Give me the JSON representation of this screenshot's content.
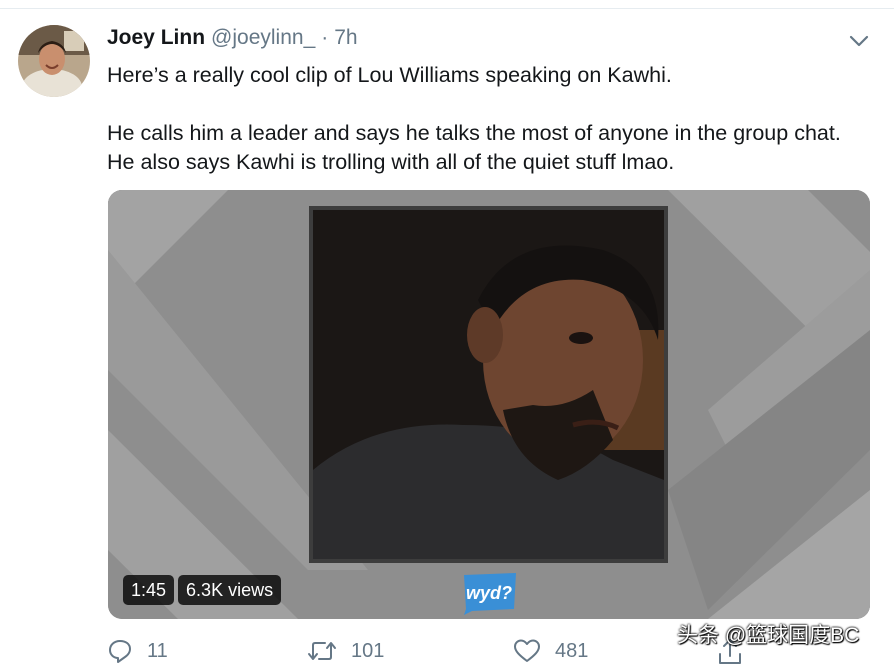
{
  "tweet": {
    "display_name": "Joey Linn",
    "handle": "@joeylinn_",
    "separator": "·",
    "time": "7h",
    "text_lines": [
      "Here’s a really cool clip of Lou Williams speaking on Kawhi.",
      "He calls him a leader and says he talks the most of anyone in the group chat.",
      "He also says Kawhi is trolling with all of the quiet stuff lmao."
    ]
  },
  "media": {
    "duration": "1:45",
    "views": "6.3K views",
    "logo_text": "wyd?"
  },
  "actions": {
    "reply_count": "11",
    "retweet_count": "101",
    "like_count": "481"
  },
  "icons": {
    "caret": "chevron-down-icon",
    "reply": "reply-icon",
    "retweet": "retweet-icon",
    "like": "heart-icon",
    "share": "share-icon"
  },
  "colors": {
    "primary_text": "#14171a",
    "secondary_text": "#657786",
    "divider": "#e6ecf0"
  },
  "watermark": "头条 @篮球国度BC"
}
